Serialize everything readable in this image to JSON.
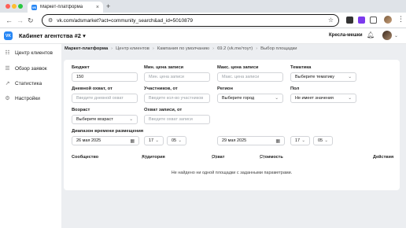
{
  "browser": {
    "tab_title": "Маркет-платформа",
    "tab_close": "×",
    "new_tab": "+",
    "url": "vk.com/adsmarket?act=community_search&ad_id=5010879"
  },
  "app": {
    "cabinet_title": "Кабинет агентства #2",
    "cabinet_chevron": "▾",
    "user_name": "Кресла-мешки",
    "sidebar": [
      {
        "label": "Центр клиентов",
        "icon": "users-icon"
      },
      {
        "label": "Обзор заявок",
        "icon": "list-icon"
      },
      {
        "label": "Статистика",
        "icon": "stats-icon"
      },
      {
        "label": "Настройки",
        "icon": "gear-icon"
      }
    ],
    "breadcrumb": [
      "Маркет-платформа",
      "Центр клиентов",
      "Кампания по умолчанию",
      "69.2 (vk.me/тоут)",
      "Выбор площадки"
    ],
    "form": {
      "budget_label": "Бюджет",
      "budget_value": "150",
      "min_price_label": "Мин. цена записи",
      "min_price_placeholder": "Мин. цена записи",
      "max_price_label": "Макс. цена записи",
      "max_price_placeholder": "Макс. цена записи",
      "topic_label": "Тематика",
      "topic_value": "Выберите тематику",
      "daily_reach_label": "Дневной охват, от",
      "daily_reach_placeholder": "Введите дневной охват",
      "members_label": "Участников, от",
      "members_placeholder": "Введите кол-во участников",
      "region_label": "Регион",
      "region_value": "Выберите город",
      "gender_label": "Пол",
      "gender_value": "Не имеет значения",
      "age_label": "Возраст",
      "age_value": "Выберите возраст",
      "post_reach_label": "Охват записи, от",
      "post_reach_placeholder": "Введите охват записи",
      "time_range_label": "Диапазон времени размещения",
      "date_from": "26 мая 2025",
      "hour_from": "17",
      "minute_from": "05",
      "date_to": "29 мая 2025",
      "hour_to": "17",
      "minute_to": "05"
    },
    "table": {
      "col_community": "Сообщество",
      "col_audience": "Аудитория",
      "col_reach": "Охват",
      "col_cost": "Стоимость",
      "col_actions": "Действия",
      "hint_mark": "[?]",
      "empty_text": "Не найдено ни одной площадки с заданными параметрами."
    }
  }
}
